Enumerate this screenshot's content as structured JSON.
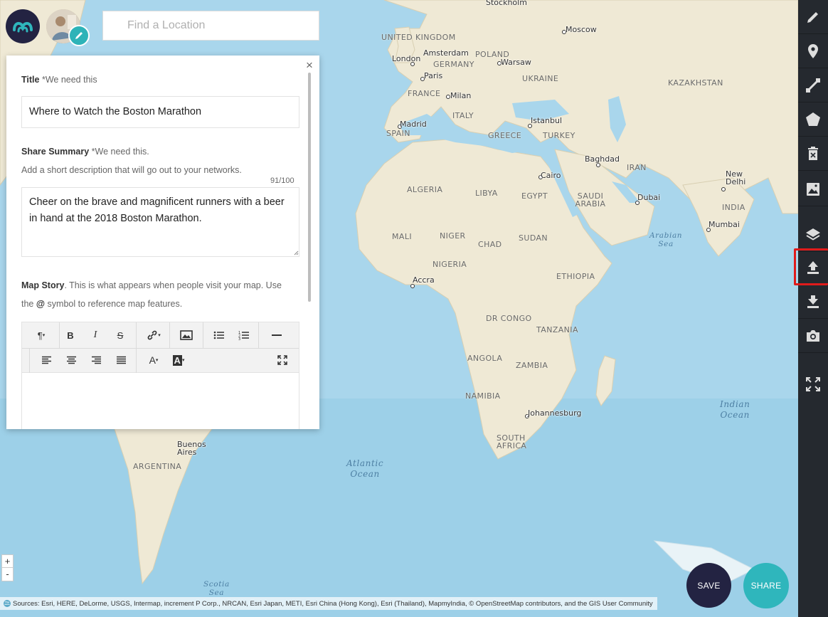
{
  "search": {
    "placeholder": "Find a Location"
  },
  "panel": {
    "close_label": "×",
    "title_label": "Title",
    "title_required": "*We need this",
    "title_value": "Where to Watch the Boston Marathon",
    "summary_label": "Share Summary",
    "summary_required": "*We need this.",
    "summary_help": "Add a short description that will go out to your networks.",
    "summary_counter": "91/100",
    "summary_value": "Cheer on the brave and magnificent runners with a beer in hand at the 2018 Boston Marathon.",
    "story_label": "Map Story",
    "story_help_1": ". This is what appears when people visit your map. Use",
    "story_help_2a": "the ",
    "story_help_at": "@",
    "story_help_2b": " symbol to reference map features.",
    "toolbar": {
      "paragraph": "¶",
      "bold": "B",
      "italic": "I",
      "strike": "S",
      "link_icon": "link-icon",
      "image_icon": "image-icon",
      "ul_icon": "bullet-list-icon",
      "ol_icon": "numbered-list-icon",
      "hr_icon": "horizontal-rule-icon",
      "align_left_icon": "align-left-icon",
      "align_center_icon": "align-center-icon",
      "align_right_icon": "align-right-icon",
      "justify_icon": "justify-icon",
      "font_color": "A",
      "bg_color": "A",
      "fullscreen_icon": "fullscreen-icon"
    }
  },
  "right_toolbar": [
    "pencil-icon",
    "map-pin-icon",
    "line-icon",
    "polygon-icon",
    "delete-icon",
    "image-icon",
    "layers-icon",
    "upload-icon",
    "download-icon",
    "camera-icon",
    "fullscreen-icon"
  ],
  "zoom": {
    "in": "+",
    "out": "-"
  },
  "attribution": "Sources: Esri, HERE, DeLorme, USGS, Intermap, increment P Corp., NRCAN, Esri Japan, METI, Esri China (Hong Kong), Esri (Thailand), MapmyIndia, © OpenStreetMap contributors, and the GIS User Community",
  "buttons": {
    "save": "SAVE",
    "share": "SHARE"
  },
  "colors": {
    "navy": "#232342",
    "teal": "#2fb6bc",
    "toolbar_bg": "#25292f",
    "highlight": "#e01b1b",
    "ocean": "#a9d6ec",
    "land": "#efe9d5"
  },
  "map_labels": {
    "countries": [
      "UNITED KINGDOM",
      "GERMANY",
      "POLAND",
      "UKRAINE",
      "KAZAKHSTAN",
      "FRANCE",
      "ITALY",
      "SPAIN",
      "GREECE",
      "TURKEY",
      "IRAN",
      "ALGERIA",
      "LIBYA",
      "EGYPT",
      "SAUDI ARABIA",
      "MALI",
      "NIGER",
      "CHAD",
      "SUDAN",
      "NIGERIA",
      "ETHIOPIA",
      "DR CONGO",
      "TANZANIA",
      "ANGOLA",
      "ZAMBIA",
      "NAMIBIA",
      "SOUTH AFRICA",
      "INDIA",
      "ARGENTINA"
    ],
    "cities": [
      "Stockholm",
      "Moscow",
      "London",
      "Amsterdam",
      "Warsaw",
      "Paris",
      "Milan",
      "Madrid",
      "Istanbul",
      "Baghdad",
      "Cairo",
      "Dubai",
      "New Delhi",
      "Mumbai",
      "Accra",
      "Johannesburg",
      "Buenos Aires"
    ],
    "seas": [
      "Arabian Sea",
      "Atlantic Ocean",
      "Indian Ocean",
      "Scotia Sea"
    ]
  }
}
